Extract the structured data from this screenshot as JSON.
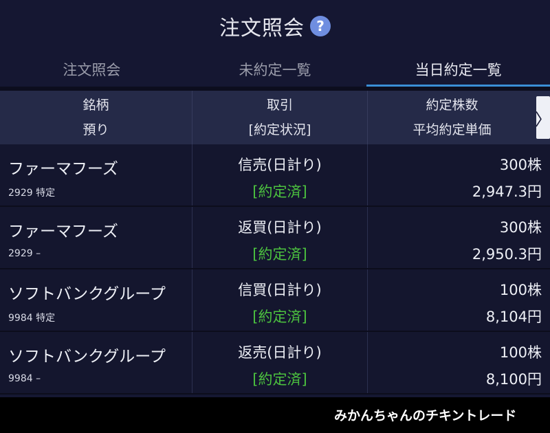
{
  "header": {
    "title": "注文照会",
    "help_icon": "?"
  },
  "tabs": [
    {
      "label": "注文照会",
      "active": false
    },
    {
      "label": "未約定一覧",
      "active": false
    },
    {
      "label": "当日約定一覧",
      "active": true
    }
  ],
  "columns": {
    "col1": {
      "line1": "銘柄",
      "line2": "預り"
    },
    "col2": {
      "line1": "取引",
      "line2": "[約定状況]"
    },
    "col3": {
      "line1": "約定株数",
      "line2": "平均約定単価"
    },
    "next_icon": "〉"
  },
  "rows": [
    {
      "name": "ファーマフーズ",
      "meta": "2929 特定",
      "trade": "信売(日計り)",
      "status": "[約定済]",
      "qty": "300株",
      "price": "2,947.3円"
    },
    {
      "name": "ファーマフーズ",
      "meta": "2929 –",
      "trade": "返買(日計り)",
      "status": "[約定済]",
      "qty": "300株",
      "price": "2,950.3円"
    },
    {
      "name": "ソフトバンクグループ",
      "meta": "9984 特定",
      "trade": "信買(日計り)",
      "status": "[約定済]",
      "qty": "100株",
      "price": "8,104円"
    },
    {
      "name": "ソフトバンクグループ",
      "meta": "9984 –",
      "trade": "返売(日計り)",
      "status": "[約定済]",
      "qty": "100株",
      "price": "8,100円"
    }
  ],
  "watermark": "みかんちゃんのチキントレード",
  "colors": {
    "background": "#151732",
    "header_row": "#252a48",
    "active_tab_underline": "#3a8fd6",
    "status_green": "#4cc23f",
    "help_icon": "#6f8ee0"
  }
}
